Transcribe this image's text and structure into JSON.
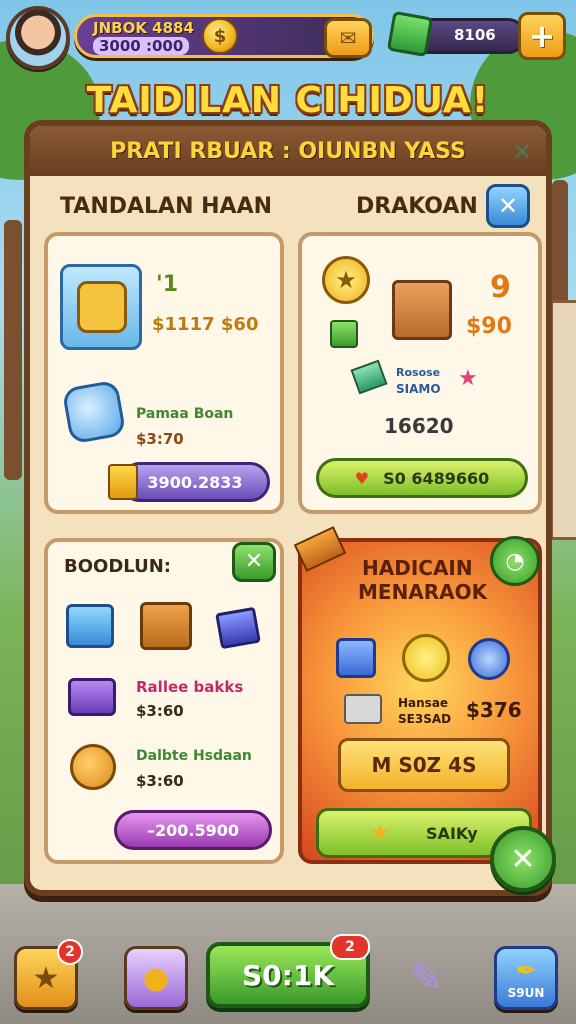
{
  "hud": {
    "player_name": "JNBOK 4884",
    "player_coins": "3000 :000",
    "gem_count": "8106",
    "plus_label": "+"
  },
  "title": "TAIDILAN CIHIDUA!",
  "panel": {
    "subtitle": "PRATI RBUAR : OIUNBN YASS",
    "close_label": "✕",
    "left_column_title": "TANDALAN HAAN",
    "right_column_title": "DRAKOAN",
    "blue_close_label": "✕"
  },
  "card_tl": {
    "item1_qty": "'1",
    "item1_price": "$1117 $60",
    "item2_name": "Pamaa Boan",
    "item2_price": "$3:70",
    "button_label": "3900.2833"
  },
  "card_tr": {
    "qty_label": "9",
    "price_top": "$90",
    "item_note_line1": "Rosose",
    "item_note_line2": "SIAMO",
    "total": "16620",
    "button_label": "S0 6489660"
  },
  "card_bl": {
    "title": "BOODLUN:",
    "close_label": "✕",
    "item1_name": "Rallee bakks",
    "item1_price": "$3:60",
    "item2_name": "Dalbte Hsdaan",
    "item2_price": "$3:60",
    "button_label": "–200.5900"
  },
  "card_br": {
    "title_line1": "HADICAIN",
    "title_line2": "MENARAOK",
    "item_desc_line1": "Hansae",
    "item_desc_line2": "SE3SAD",
    "item_price": "$376",
    "yellow_button_label": "M  S0Z 4S",
    "green_button_label": "SAIKy"
  },
  "bottom_nav": {
    "chest_badge": "2",
    "center_label": "S0:1K",
    "center_badge": "2",
    "right_label": "S9UN"
  },
  "colors": {
    "panel_bg": "#f4e1bd",
    "panel_border": "#6a3f20",
    "title_yellow": "#ffdd3c"
  }
}
